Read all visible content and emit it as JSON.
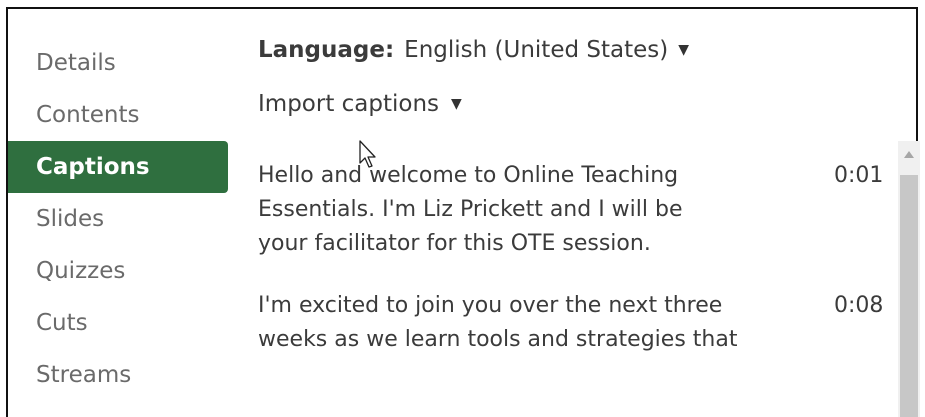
{
  "sidebar": {
    "items": [
      {
        "label": "Details",
        "active": false
      },
      {
        "label": "Contents",
        "active": false
      },
      {
        "label": "Captions",
        "active": true
      },
      {
        "label": "Slides",
        "active": false
      },
      {
        "label": "Quizzes",
        "active": false
      },
      {
        "label": "Cuts",
        "active": false
      },
      {
        "label": "Streams",
        "active": false
      }
    ]
  },
  "language": {
    "label": "Language:",
    "value": "English (United States)",
    "caret": "▼"
  },
  "import": {
    "label": "Import captions",
    "caret": "▼"
  },
  "captions": [
    {
      "text": "Hello and welcome to Online Teaching Essentials. I'm Liz Prickett and I will be your facilitator for this OTE session.",
      "time": "0:01"
    },
    {
      "text": "I'm excited to join you over the next three weeks as we learn tools and strategies that",
      "time": "0:08"
    }
  ],
  "icons": {
    "cursor": "mouse-pointer-icon",
    "language_caret": "chevron-down-icon",
    "import_caret": "chevron-down-icon",
    "scroll_up": "scroll-up-arrow-icon"
  },
  "colors": {
    "active_tab_bg": "#2f6f3f",
    "active_tab_text": "#ffffff",
    "nav_text": "#6a6a6a",
    "body_text": "#3b3b3b"
  }
}
